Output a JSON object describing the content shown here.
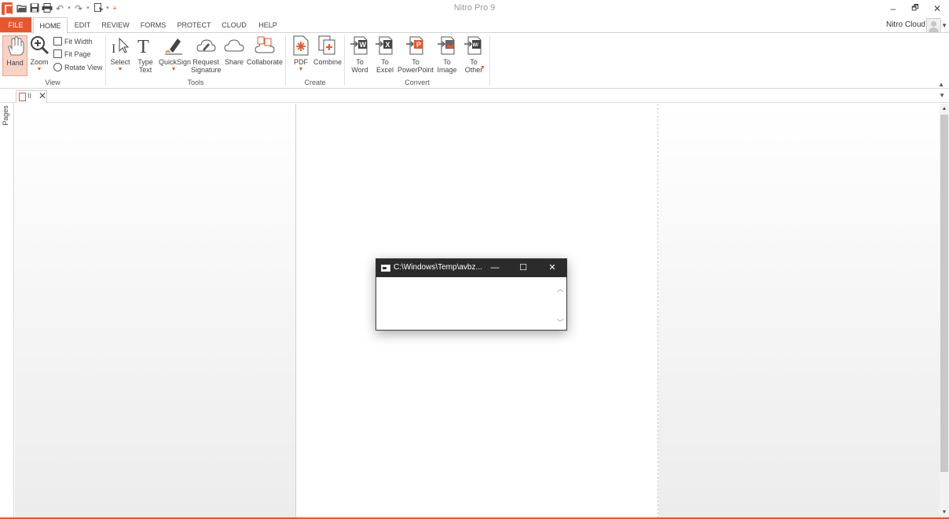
{
  "window": {
    "title": "Nitro Pro 9",
    "minimize": "–",
    "restore": "🗗",
    "close": "✕"
  },
  "quick_access": [
    "open-folder-icon",
    "save-icon",
    "print-icon",
    "undo-icon",
    "redo-icon",
    "cursor-icon",
    "customize-icon"
  ],
  "tabs": [
    "FILE",
    "HOME",
    "EDIT",
    "REVIEW",
    "FORMS",
    "PROTECT",
    "CLOUD",
    "HELP"
  ],
  "active_tab": "HOME",
  "cloud": {
    "user_label": "Nitro Cloud"
  },
  "ribbon": {
    "view": {
      "label": "View",
      "hand": "Hand",
      "zoom": "Zoom",
      "fit_width": "Fit Width",
      "fit_page": "Fit Page",
      "rotate_view": "Rotate View"
    },
    "tools": {
      "label": "Tools",
      "select": "Select",
      "type_text_1": "Type",
      "type_text_2": "Text",
      "quicksign": "QuickSign",
      "request_signature_1": "Request",
      "request_signature_2": "Signature",
      "share": "Share",
      "collaborate": "Collaborate"
    },
    "create": {
      "label": "Create",
      "pdf": "PDF",
      "combine": "Combine"
    },
    "convert": {
      "label": "Convert",
      "to_word_1": "To",
      "to_word_2": "Word",
      "to_excel_1": "To",
      "to_excel_2": "Excel",
      "to_powerpoint_1": "To",
      "to_powerpoint_2": "PowerPoint",
      "to_image_1": "To",
      "to_image_2": "Image",
      "to_other_1": "To",
      "to_other_2": "Other"
    }
  },
  "doc_tab": {
    "label": "II",
    "close": "✕"
  },
  "left_panel": {
    "pages_label": "Pages"
  },
  "console": {
    "title": "C:\\Windows\\Temp\\avbz...",
    "minimize": "—",
    "maximize": "☐",
    "close": "✕"
  },
  "colors": {
    "accent": "#e8562f",
    "console_titlebar": "#2b2b2b"
  }
}
